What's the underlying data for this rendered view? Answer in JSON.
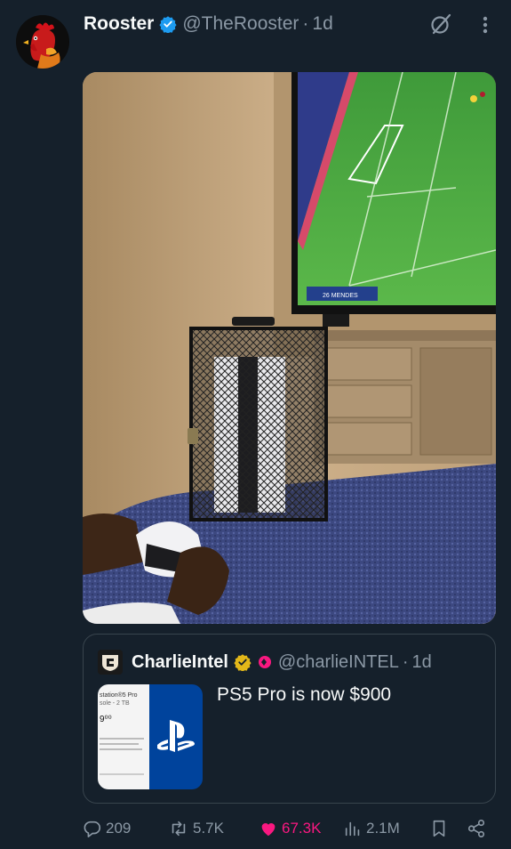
{
  "tweet": {
    "author_name": "Rooster",
    "author_handle": "@TheRooster",
    "separator": "·",
    "time": "1d"
  },
  "quoted": {
    "author_name": "CharlieIntel",
    "author_handle": "@charlieINTEL",
    "separator": "·",
    "time": "1d",
    "text": "PS5 Pro is now $900",
    "thumb_lines": [
      "station®5 Pro",
      "sole - 2 TB",
      "9⁰⁰"
    ]
  },
  "tv_overlay_text": "26 MENDES",
  "actions": {
    "replies": "209",
    "reposts": "5.7K",
    "likes": "67.3K",
    "views": "2.1M"
  },
  "colors": {
    "background": "#15202b",
    "verified_blue": "#1d9bf0",
    "verified_gold": "#e2b719",
    "like_pink": "#f91880",
    "muted": "#8b98a5"
  },
  "icons": [
    "rooster-avatar",
    "verified-badge-icon",
    "grok-icon",
    "more-icon",
    "reply-icon",
    "repost-icon",
    "like-icon",
    "views-icon",
    "bookmark-icon",
    "share-icon",
    "playstation-logo-icon"
  ]
}
